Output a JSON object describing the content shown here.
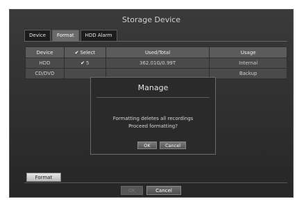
{
  "window": {
    "title": "Storage Device"
  },
  "tabs": [
    {
      "label": "Device"
    },
    {
      "label": "Format"
    },
    {
      "label": "HDD Alarm"
    }
  ],
  "table": {
    "headers": [
      "Device",
      "Select",
      "Used/Total",
      "Usage"
    ],
    "rows": [
      {
        "device": "HDD",
        "select": "5",
        "used_total": "362.01G/0.99T",
        "usage": "Internal"
      },
      {
        "device": "CD/DVD",
        "select": "",
        "used_total": "",
        "usage": "Backup"
      }
    ]
  },
  "format_button": "Format",
  "bottom": {
    "ok": "OK",
    "cancel": "Cancel"
  },
  "dialog": {
    "title": "Manage",
    "line1": "Formatting deletes all recordings",
    "line2": "Proceed formatting?",
    "ok": "OK",
    "cancel": "Cancel"
  }
}
